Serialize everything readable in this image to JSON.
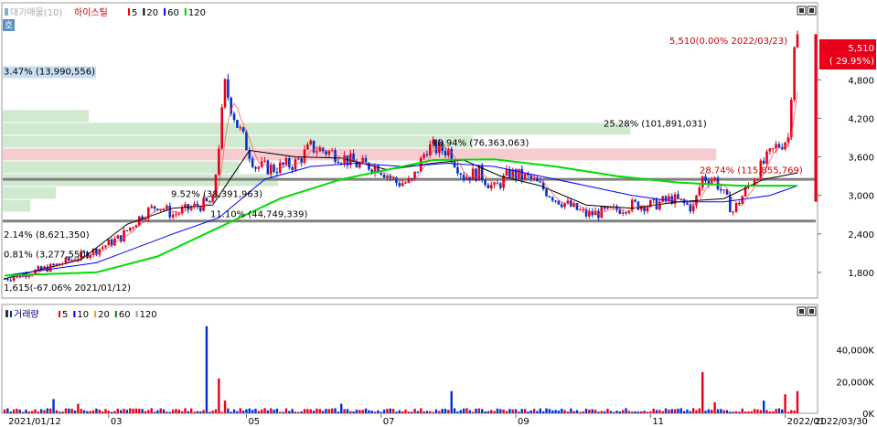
{
  "price_panel": {
    "legend": {
      "period": "대기매물(10)",
      "name": "하이스틸",
      "ma_items": [
        {
          "label": "5",
          "color": "#ff0000"
        },
        {
          "label": "20",
          "color": "#000000"
        },
        {
          "label": "60",
          "color": "#0000ff"
        },
        {
          "label": "120",
          "color": "#00cc00"
        }
      ]
    },
    "corner_tag": "호",
    "last_price_label": "5,510",
    "last_change_label": "( 29.95%)",
    "max_annotation": "5,510(0.00% 2022/03/23)",
    "min_annotation": "1,615(-67.06% 2021/01/12)",
    "volume_profile_labels": [
      {
        "text": "3.47% (13,990,556)",
        "price": 4940
      },
      {
        "text": "25.28% (101,891,031)",
        "price": 4125
      },
      {
        "text": "18.94% (76,363,063)",
        "price": 3830
      },
      {
        "text": "28.74% (115,855,769)",
        "price": 3400
      },
      {
        "text": "9.52% (38,391,963)",
        "price": 3030
      },
      {
        "text": "11.10% (44,749,339)",
        "price": 2720
      },
      {
        "text": "2.14% (8,621,350)",
        "price": 2400
      },
      {
        "text": "0.81% (3,277,550)",
        "price": 2090
      }
    ]
  },
  "volume_panel": {
    "legend": {
      "name": "거래량",
      "ma_items": [
        {
          "label": "5",
          "color": "#ff0000"
        },
        {
          "label": "10",
          "color": "#0000ff"
        },
        {
          "label": "20",
          "color": "#ff9900"
        },
        {
          "label": "60",
          "color": "#008800"
        },
        {
          "label": "120",
          "color": "#999999"
        }
      ]
    }
  },
  "chart_data": [
    {
      "type": "candlestick",
      "ylim": [
        1400,
        6000
      ],
      "yticks": [
        "4,800",
        "4,200",
        "3,600",
        "3,000",
        "2,400",
        "1,800"
      ],
      "ytick_values": [
        4800,
        4200,
        3600,
        3000,
        2400,
        1800
      ],
      "xticks": [
        "2021/01/12",
        "03",
        "05",
        "07",
        "09",
        "11",
        "2022/01",
        "03",
        "2022/03/30"
      ],
      "price_path": [
        [
          0,
          1700
        ],
        [
          15,
          1880
        ],
        [
          30,
          2150
        ],
        [
          38,
          2350
        ],
        [
          45,
          2700
        ],
        [
          50,
          2850
        ],
        [
          55,
          2700
        ],
        [
          62,
          2820
        ],
        [
          68,
          2900
        ],
        [
          72,
          4700
        ],
        [
          76,
          4100
        ],
        [
          82,
          3450
        ],
        [
          88,
          3420
        ],
        [
          95,
          3500
        ],
        [
          100,
          3750
        ],
        [
          108,
          3650
        ],
        [
          115,
          3480
        ],
        [
          122,
          3450
        ],
        [
          128,
          3200
        ],
        [
          133,
          3200
        ],
        [
          138,
          3750
        ],
        [
          145,
          3700
        ],
        [
          150,
          3300
        ],
        [
          155,
          3350
        ],
        [
          160,
          3100
        ],
        [
          165,
          3350
        ],
        [
          172,
          3250
        ],
        [
          180,
          2950
        ],
        [
          190,
          2700
        ],
        [
          198,
          2750
        ],
        [
          205,
          2850
        ],
        [
          212,
          2850
        ],
        [
          218,
          2950
        ],
        [
          225,
          2800
        ],
        [
          228,
          3280
        ],
        [
          232,
          3250
        ],
        [
          238,
          2750
        ],
        [
          243,
          3150
        ],
        [
          248,
          3500
        ],
        [
          252,
          3750
        ],
        [
          256,
          3900
        ],
        [
          258,
          5400
        ],
        [
          259,
          5510
        ]
      ],
      "ma_lines": [
        {
          "name": "20",
          "color": "#000000",
          "values": [
            [
              0,
              1700
            ],
            [
              25,
              2000
            ],
            [
              40,
              2550
            ],
            [
              55,
              2800
            ],
            [
              68,
              2850
            ],
            [
              80,
              3700
            ],
            [
              95,
              3600
            ],
            [
              110,
              3580
            ],
            [
              125,
              3400
            ],
            [
              140,
              3500
            ],
            [
              150,
              3550
            ],
            [
              162,
              3300
            ],
            [
              175,
              3150
            ],
            [
              190,
              2850
            ],
            [
              205,
              2800
            ],
            [
              220,
              2900
            ],
            [
              235,
              2950
            ],
            [
              248,
              3250
            ],
            [
              259,
              3350
            ]
          ]
        },
        {
          "name": "60",
          "color": "#0000ff",
          "values": [
            [
              0,
              1750
            ],
            [
              30,
              1950
            ],
            [
              55,
              2400
            ],
            [
              70,
              2650
            ],
            [
              85,
              3250
            ],
            [
              100,
              3450
            ],
            [
              115,
              3500
            ],
            [
              130,
              3450
            ],
            [
              145,
              3500
            ],
            [
              160,
              3450
            ],
            [
              175,
              3300
            ],
            [
              190,
              3150
            ],
            [
              205,
              3000
            ],
            [
              220,
              2900
            ],
            [
              235,
              2900
            ],
            [
              250,
              3000
            ],
            [
              259,
              3150
            ]
          ]
        },
        {
          "name": "120",
          "color": "#00dd00",
          "values": [
            [
              0,
              1750
            ],
            [
              30,
              1800
            ],
            [
              50,
              2050
            ],
            [
              70,
              2500
            ],
            [
              90,
              2950
            ],
            [
              110,
              3250
            ],
            [
              125,
              3400
            ],
            [
              140,
              3550
            ],
            [
              160,
              3560
            ],
            [
              180,
              3450
            ],
            [
              200,
              3300
            ],
            [
              220,
              3200
            ],
            [
              240,
              3150
            ],
            [
              259,
              3150
            ]
          ]
        }
      ],
      "volume_profile_bands": [
        {
          "low": 4130,
          "high": 4330,
          "share": 3.47
        },
        {
          "low": 3930,
          "high": 4130,
          "share": 25.28
        },
        {
          "low": 3730,
          "high": 3930,
          "share": 18.94
        },
        {
          "low": 3530,
          "high": 3730,
          "share": 28.74
        },
        {
          "low": 3330,
          "high": 3530,
          "share": 9.52
        },
        {
          "low": 3130,
          "high": 3330,
          "share": 11.1
        },
        {
          "low": 2930,
          "high": 3130,
          "share": 2.14
        },
        {
          "low": 2730,
          "high": 2930,
          "share": 0.81
        }
      ],
      "support_lines": [
        3250,
        2600
      ]
    },
    {
      "type": "bar",
      "ylim": [
        0,
        56000
      ],
      "yticks": [
        "40,000K",
        "20,000K",
        "0K"
      ],
      "ytick_values": [
        40000,
        20000,
        0
      ],
      "spikes": [
        [
          16,
          9000
        ],
        [
          24,
          6000
        ],
        [
          66,
          55000
        ],
        [
          70,
          22000
        ],
        [
          72,
          8000
        ],
        [
          110,
          6000
        ],
        [
          146,
          14000
        ],
        [
          228,
          26000
        ],
        [
          232,
          7000
        ],
        [
          248,
          8000
        ],
        [
          255,
          12000
        ],
        [
          259,
          14000
        ]
      ]
    }
  ]
}
